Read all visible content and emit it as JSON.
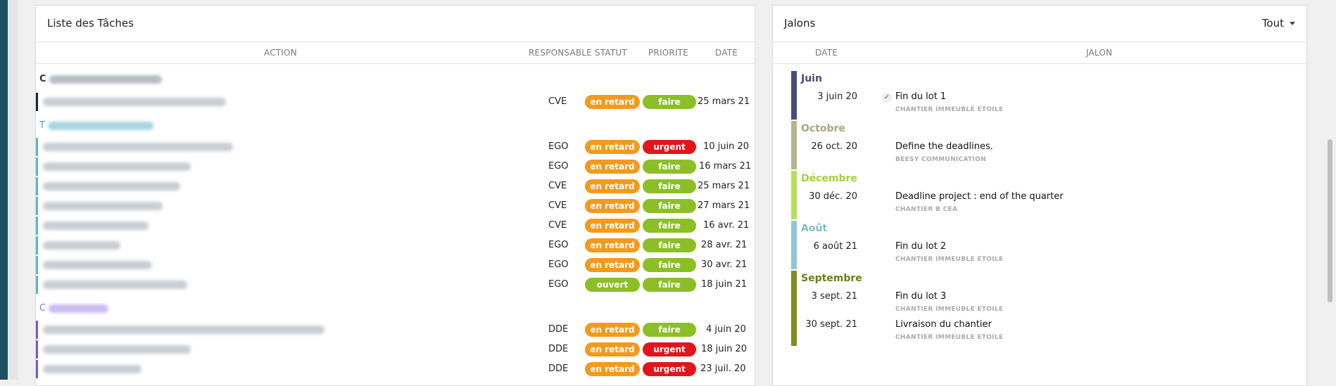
{
  "tasks_panel": {
    "title": "Liste des Tâches",
    "columns": {
      "action": "ACTION",
      "responsable": "RESPONSABLE",
      "statut": "STATUT",
      "priorite": "PRIORITE",
      "date": "DATE"
    },
    "group_initials": [
      "C",
      "T",
      "C"
    ],
    "rows": [
      {
        "responsable": "CVE",
        "statut": "en retard",
        "priorite": "faire",
        "date": "25 mars 21"
      },
      {
        "responsable": "EGO",
        "statut": "en retard",
        "priorite": "urgent",
        "date": "10 juin 20"
      },
      {
        "responsable": "EGO",
        "statut": "en retard",
        "priorite": "faire",
        "date": "16 mars 21"
      },
      {
        "responsable": "CVE",
        "statut": "en retard",
        "priorite": "faire",
        "date": "25 mars 21"
      },
      {
        "responsable": "CVE",
        "statut": "en retard",
        "priorite": "faire",
        "date": "27 mars 21"
      },
      {
        "responsable": "CVE",
        "statut": "en retard",
        "priorite": "faire",
        "date": "16 avr. 21"
      },
      {
        "responsable": "EGO",
        "statut": "en retard",
        "priorite": "faire",
        "date": "28 avr. 21"
      },
      {
        "responsable": "EGO",
        "statut": "en retard",
        "priorite": "faire",
        "date": "30 avr. 21"
      },
      {
        "responsable": "EGO",
        "statut": "ouvert",
        "priorite": "faire",
        "date": "18 juin 21"
      },
      {
        "responsable": "DDE",
        "statut": "en retard",
        "priorite": "faire",
        "date": "4 juin 20"
      },
      {
        "responsable": "DDE",
        "statut": "en retard",
        "priorite": "urgent",
        "date": "18 juin 20"
      },
      {
        "responsable": "DDE",
        "statut": "en retard",
        "priorite": "urgent",
        "date": "23 juil. 20"
      }
    ],
    "colors": {
      "en_retard": "#f39a1d",
      "ouvert": "#8cbf26",
      "faire": "#8cbf26",
      "urgent": "#e0161c"
    }
  },
  "milestones_panel": {
    "title": "Jalons",
    "filter": "Tout",
    "columns": {
      "date": "DATE",
      "jalon": "JALON"
    },
    "months": [
      {
        "label": "Juin",
        "color": "#474b7a",
        "items": [
          {
            "date": "3 juin 20",
            "title": "Fin du lot 1",
            "sub": "CHANTIER IMMEUBLE ETOILE",
            "checked": true
          }
        ]
      },
      {
        "label": "Octobre",
        "color": "#b7b490",
        "items": [
          {
            "date": "26 oct. 20",
            "title": "Define the deadlines.",
            "sub": "BEESY COMMUNICATION"
          }
        ]
      },
      {
        "label": "Décembre",
        "color": "#b5e05a",
        "items": [
          {
            "date": "30 déc. 20",
            "title": "Deadline project : end of the quarter",
            "sub": "CHANTIER B CEA"
          }
        ]
      },
      {
        "label": "Août",
        "color": "#8ec6d8",
        "items": [
          {
            "date": "6 août 21",
            "title": "Fin du lot 2",
            "sub": "CHANTIER IMMEUBLE ETOILE"
          }
        ]
      },
      {
        "label": "Septembre",
        "color": "#7f8f1a",
        "items": [
          {
            "date": "3 sept. 21",
            "title": "Fin du lot 3",
            "sub": "CHANTIER IMMEUBLE ETOILE"
          },
          {
            "date": "30 sept. 21",
            "title": "Livraison du chantier",
            "sub": "CHANTIER IMMEUBLE ETOILE"
          }
        ]
      }
    ]
  }
}
